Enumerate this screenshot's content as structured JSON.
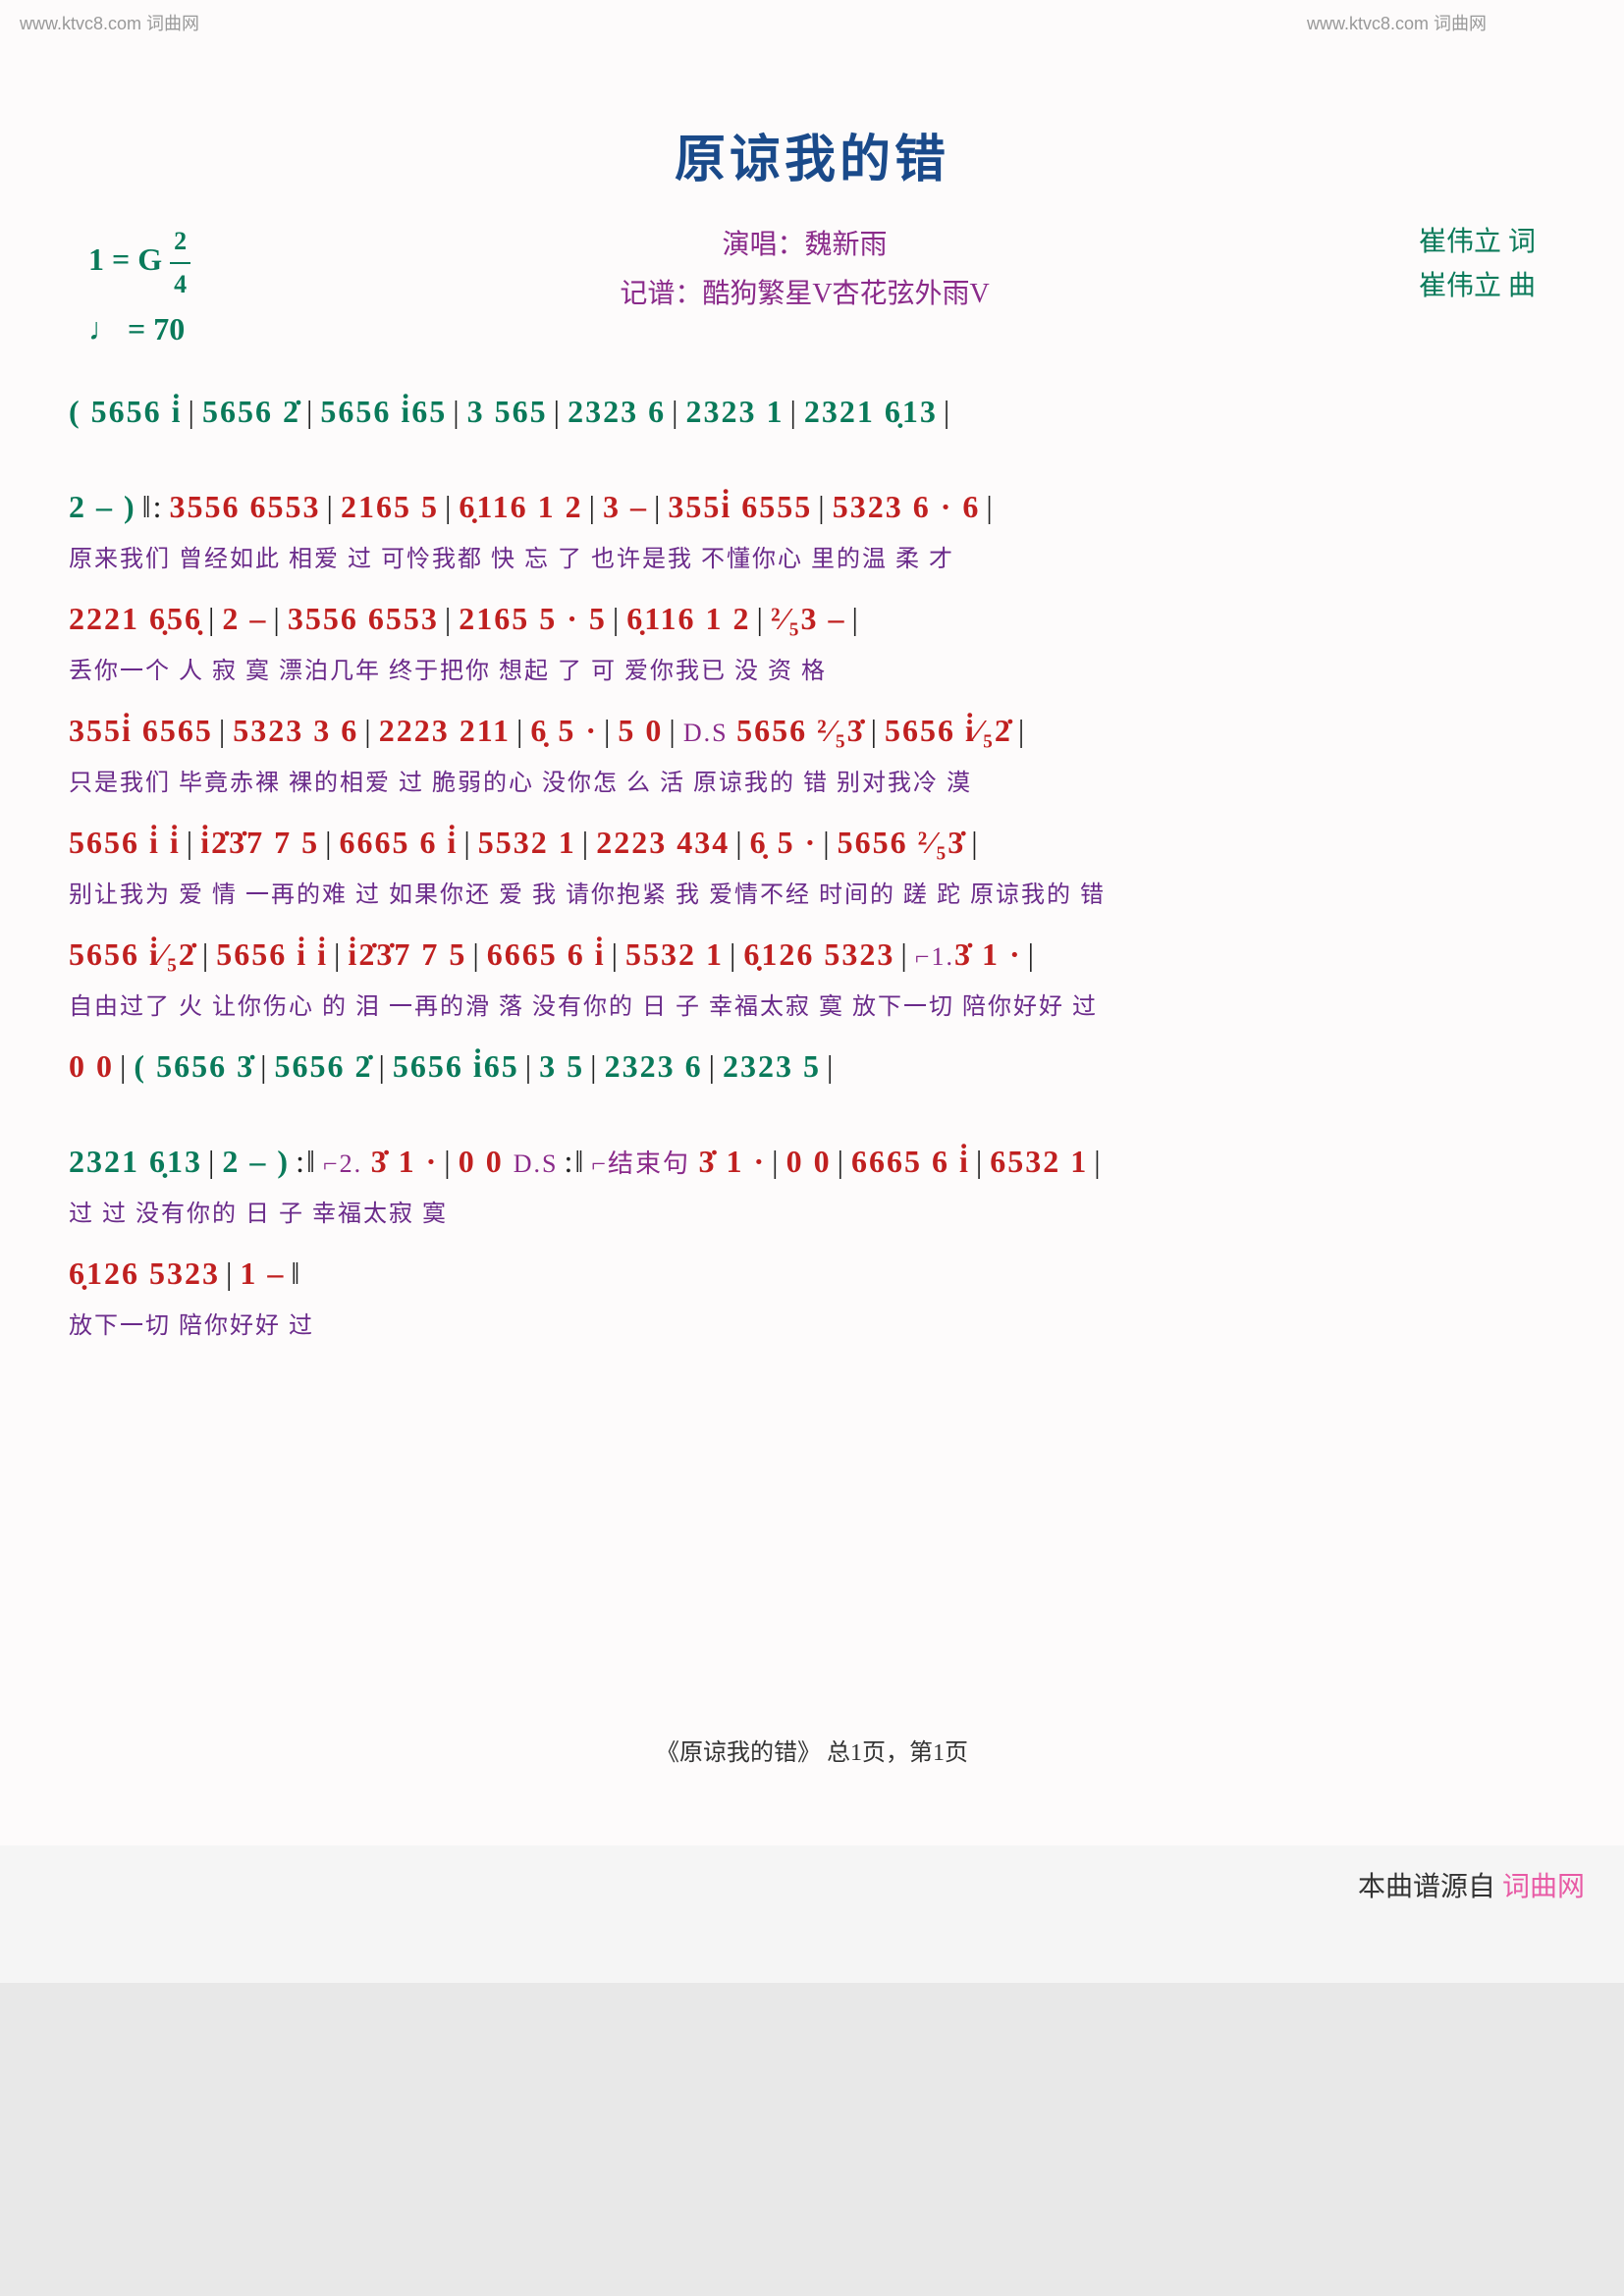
{
  "watermark": "www.ktvc8.com 词曲网",
  "title": "原谅我的错",
  "header": {
    "key": "1 = G",
    "time_num": "2",
    "time_den": "4",
    "tempo": "♩ = 70",
    "performer_label": "演唱：",
    "performer": "魏新雨",
    "transcriber_label": "记谱：",
    "transcriber": "酷狗繁星V杏花弦外雨V",
    "lyricist": "崔伟立 词",
    "composer": "崔伟立 曲"
  },
  "lines": [
    {
      "segs": [
        {
          "cls": "notes-green",
          "txt": "( 5656 i̇"
        },
        {
          "cls": "bar",
          "txt": "|"
        },
        {
          "cls": "notes-green",
          "txt": "5656 2̇"
        },
        {
          "cls": "bar",
          "txt": "|"
        },
        {
          "cls": "notes-green",
          "txt": "5656 i̇65"
        },
        {
          "cls": "bar",
          "txt": "|"
        },
        {
          "cls": "notes-green",
          "txt": "3  565"
        },
        {
          "cls": "bar",
          "txt": "|"
        },
        {
          "cls": "notes-green",
          "txt": "2323 6"
        },
        {
          "cls": "bar",
          "txt": "|"
        },
        {
          "cls": "notes-green",
          "txt": "2323 1"
        },
        {
          "cls": "bar",
          "txt": "|"
        },
        {
          "cls": "notes-green",
          "txt": "2321 6̣13"
        },
        {
          "cls": "bar",
          "txt": "|"
        }
      ],
      "lyric": ""
    },
    {
      "segs": [
        {
          "cls": "notes-green",
          "txt": "2  –  )"
        },
        {
          "cls": "bar",
          "txt": "‖:"
        },
        {
          "cls": "notes-red",
          "txt": "3556 6553"
        },
        {
          "cls": "bar",
          "txt": "|"
        },
        {
          "cls": "notes-red",
          "txt": "2165 5"
        },
        {
          "cls": "bar",
          "txt": "|"
        },
        {
          "cls": "notes-red",
          "txt": "6̣116 1 2"
        },
        {
          "cls": "bar",
          "txt": "|"
        },
        {
          "cls": "notes-red",
          "txt": "3  –"
        },
        {
          "cls": "bar",
          "txt": "|"
        },
        {
          "cls": "notes-red",
          "txt": "355i̇ 6555"
        },
        {
          "cls": "bar",
          "txt": "|"
        },
        {
          "cls": "notes-red",
          "txt": "5323 6 · 6"
        },
        {
          "cls": "bar",
          "txt": "|"
        }
      ],
      "lyric": "                原来我们 曾经如此     相爱    过    可怜我都 快 忘   了        也许是我 不懂你心    里的温   柔  才"
    },
    {
      "segs": [
        {
          "cls": "notes-red",
          "txt": "2221 6̣56̣"
        },
        {
          "cls": "bar",
          "txt": "|"
        },
        {
          "cls": "notes-red",
          "txt": "2  –"
        },
        {
          "cls": "bar",
          "txt": "|"
        },
        {
          "cls": "notes-red",
          "txt": "3556 6553"
        },
        {
          "cls": "bar",
          "txt": "|"
        },
        {
          "cls": "notes-red",
          "txt": "2165 5 · 5"
        },
        {
          "cls": "bar",
          "txt": "|"
        },
        {
          "cls": "notes-red",
          "txt": "6̣116 1 2"
        },
        {
          "cls": "bar",
          "txt": "|"
        },
        {
          "cls": "notes-red",
          "txt": "²⁄₅3  –"
        },
        {
          "cls": "bar",
          "txt": "|"
        }
      ],
      "lyric": "丢你一个  人  寂     寞         漂泊几年 终于把你    想起    了   可    爱你我已 没 资    格"
    },
    {
      "segs": [
        {
          "cls": "notes-red",
          "txt": "355i̇ 6565"
        },
        {
          "cls": "bar",
          "txt": "|"
        },
        {
          "cls": "notes-red",
          "txt": "5323 3 6"
        },
        {
          "cls": "bar",
          "txt": "|"
        },
        {
          "cls": "notes-red",
          "txt": "2223 211"
        },
        {
          "cls": "bar",
          "txt": "|"
        },
        {
          "cls": "notes-red",
          "txt": "6̣ 5 ·"
        },
        {
          "cls": "bar",
          "txt": "|"
        },
        {
          "cls": "notes-red",
          "txt": "5  0"
        },
        {
          "cls": "bar",
          "txt": "|"
        },
        {
          "cls": "notes-purple",
          "txt": "D.S "
        },
        {
          "cls": "notes-red",
          "txt": "5656 ²⁄₅3̇"
        },
        {
          "cls": "bar",
          "txt": "|"
        },
        {
          "cls": "notes-red",
          "txt": "5656 i̇⁄₅2̇"
        },
        {
          "cls": "bar",
          "txt": "|"
        }
      ],
      "lyric": "只是我们 毕竟赤裸    裸的相爱 过    脆弱的心 没你怎    么 活                    原谅我的  错    别对我冷  漠"
    },
    {
      "segs": [
        {
          "cls": "notes-red",
          "txt": "5656 i̇ i̇"
        },
        {
          "cls": "bar",
          "txt": "|"
        },
        {
          "cls": "notes-red",
          "txt": "i̇2̇3̇7 7 5"
        },
        {
          "cls": "bar",
          "txt": "|"
        },
        {
          "cls": "notes-red",
          "txt": "6665 6 i̇"
        },
        {
          "cls": "bar",
          "txt": "|"
        },
        {
          "cls": "notes-red",
          "txt": "5532 1"
        },
        {
          "cls": "bar",
          "txt": "|"
        },
        {
          "cls": "notes-red",
          "txt": "2223 434"
        },
        {
          "cls": "bar",
          "txt": "|"
        },
        {
          "cls": "notes-red",
          "txt": "6̣ 5 ·"
        },
        {
          "cls": "bar",
          "txt": "|"
        },
        {
          "cls": "notes-red",
          "txt": "5656 ²⁄₅3̇"
        },
        {
          "cls": "bar",
          "txt": "|"
        }
      ],
      "lyric": "别让我为 爱 情   一再的难  过    如果你还 爱 我   请你抱紧 我   爱情不经 时间的   蹉  跎     原谅我的  错"
    },
    {
      "segs": [
        {
          "cls": "notes-red",
          "txt": "5656 i̇⁄₅2̇"
        },
        {
          "cls": "bar",
          "txt": "|"
        },
        {
          "cls": "notes-red",
          "txt": "5656 i̇ i̇"
        },
        {
          "cls": "bar",
          "txt": "|"
        },
        {
          "cls": "notes-red",
          "txt": "i̇2̇3̇7 7 5"
        },
        {
          "cls": "bar",
          "txt": "|"
        },
        {
          "cls": "notes-red",
          "txt": "6665 6 i̇"
        },
        {
          "cls": "bar",
          "txt": "|"
        },
        {
          "cls": "notes-red",
          "txt": "5532 1"
        },
        {
          "cls": "bar",
          "txt": "|"
        },
        {
          "cls": "notes-red",
          "txt": "6̣126 5323"
        },
        {
          "cls": "bar",
          "txt": "|"
        },
        {
          "cls": "notes-purple",
          "txt": "⌐1."
        },
        {
          "cls": "notes-red",
          "txt": "3̇ 1 ·"
        },
        {
          "cls": "bar",
          "txt": "|"
        }
      ],
      "lyric": "自由过了  火    让你伤心 的 泪   一再的滑  落    没有你的 日 子   幸福太寂 寞   放下一切 陪你好好        过"
    },
    {
      "segs": [
        {
          "cls": "notes-red",
          "txt": "0  0"
        },
        {
          "cls": "bar",
          "txt": "|"
        },
        {
          "cls": "notes-green",
          "txt": "( 5656 3̇"
        },
        {
          "cls": "bar",
          "txt": "|"
        },
        {
          "cls": "notes-green",
          "txt": "5656 2̇"
        },
        {
          "cls": "bar",
          "txt": "|"
        },
        {
          "cls": "notes-green",
          "txt": "5656 i̇65"
        },
        {
          "cls": "bar",
          "txt": "|"
        },
        {
          "cls": "notes-green",
          "txt": "3  5"
        },
        {
          "cls": "bar",
          "txt": "|"
        },
        {
          "cls": "notes-green",
          "txt": "2323 6"
        },
        {
          "cls": "bar",
          "txt": "|"
        },
        {
          "cls": "notes-green",
          "txt": "2323 5"
        },
        {
          "cls": "bar",
          "txt": "|"
        }
      ],
      "lyric": ""
    },
    {
      "segs": [
        {
          "cls": "notes-green",
          "txt": "2321 6̣13"
        },
        {
          "cls": "bar",
          "txt": "|"
        },
        {
          "cls": "notes-green",
          "txt": "2  –  )"
        },
        {
          "cls": "bar",
          "txt": ":‖"
        },
        {
          "cls": "notes-purple",
          "txt": "⌐2. "
        },
        {
          "cls": "notes-red",
          "txt": "3̇ 1 ·"
        },
        {
          "cls": "bar",
          "txt": "|"
        },
        {
          "cls": "notes-red",
          "txt": "0  0 "
        },
        {
          "cls": "notes-purple",
          "txt": "D.S"
        },
        {
          "cls": "bar",
          "txt": ":‖"
        },
        {
          "cls": "notes-purple",
          "txt": "⌐结束句 "
        },
        {
          "cls": "notes-red",
          "txt": "3̇ 1 ·"
        },
        {
          "cls": "bar",
          "txt": "|"
        },
        {
          "cls": "notes-red",
          "txt": "0  0"
        },
        {
          "cls": "bar",
          "txt": "|"
        },
        {
          "cls": "notes-red",
          "txt": "6665 6 i̇"
        },
        {
          "cls": "bar",
          "txt": "|"
        },
        {
          "cls": "notes-red",
          "txt": "6532 1"
        },
        {
          "cls": "bar",
          "txt": "|"
        }
      ],
      "lyric": "                                过                        过              没有你的 日 子   幸福太寂 寞"
    },
    {
      "segs": [
        {
          "cls": "notes-red",
          "txt": "6̣126 5323"
        },
        {
          "cls": "bar",
          "txt": "|"
        },
        {
          "cls": "notes-red",
          "txt": "1  –"
        },
        {
          "cls": "bar",
          "txt": "‖"
        }
      ],
      "lyric": "放下一切 陪你好好    过"
    }
  ],
  "page_label": "《原谅我的错》 总1页，第1页",
  "footer": {
    "prefix": "本曲谱源自",
    "link": "词曲网"
  }
}
